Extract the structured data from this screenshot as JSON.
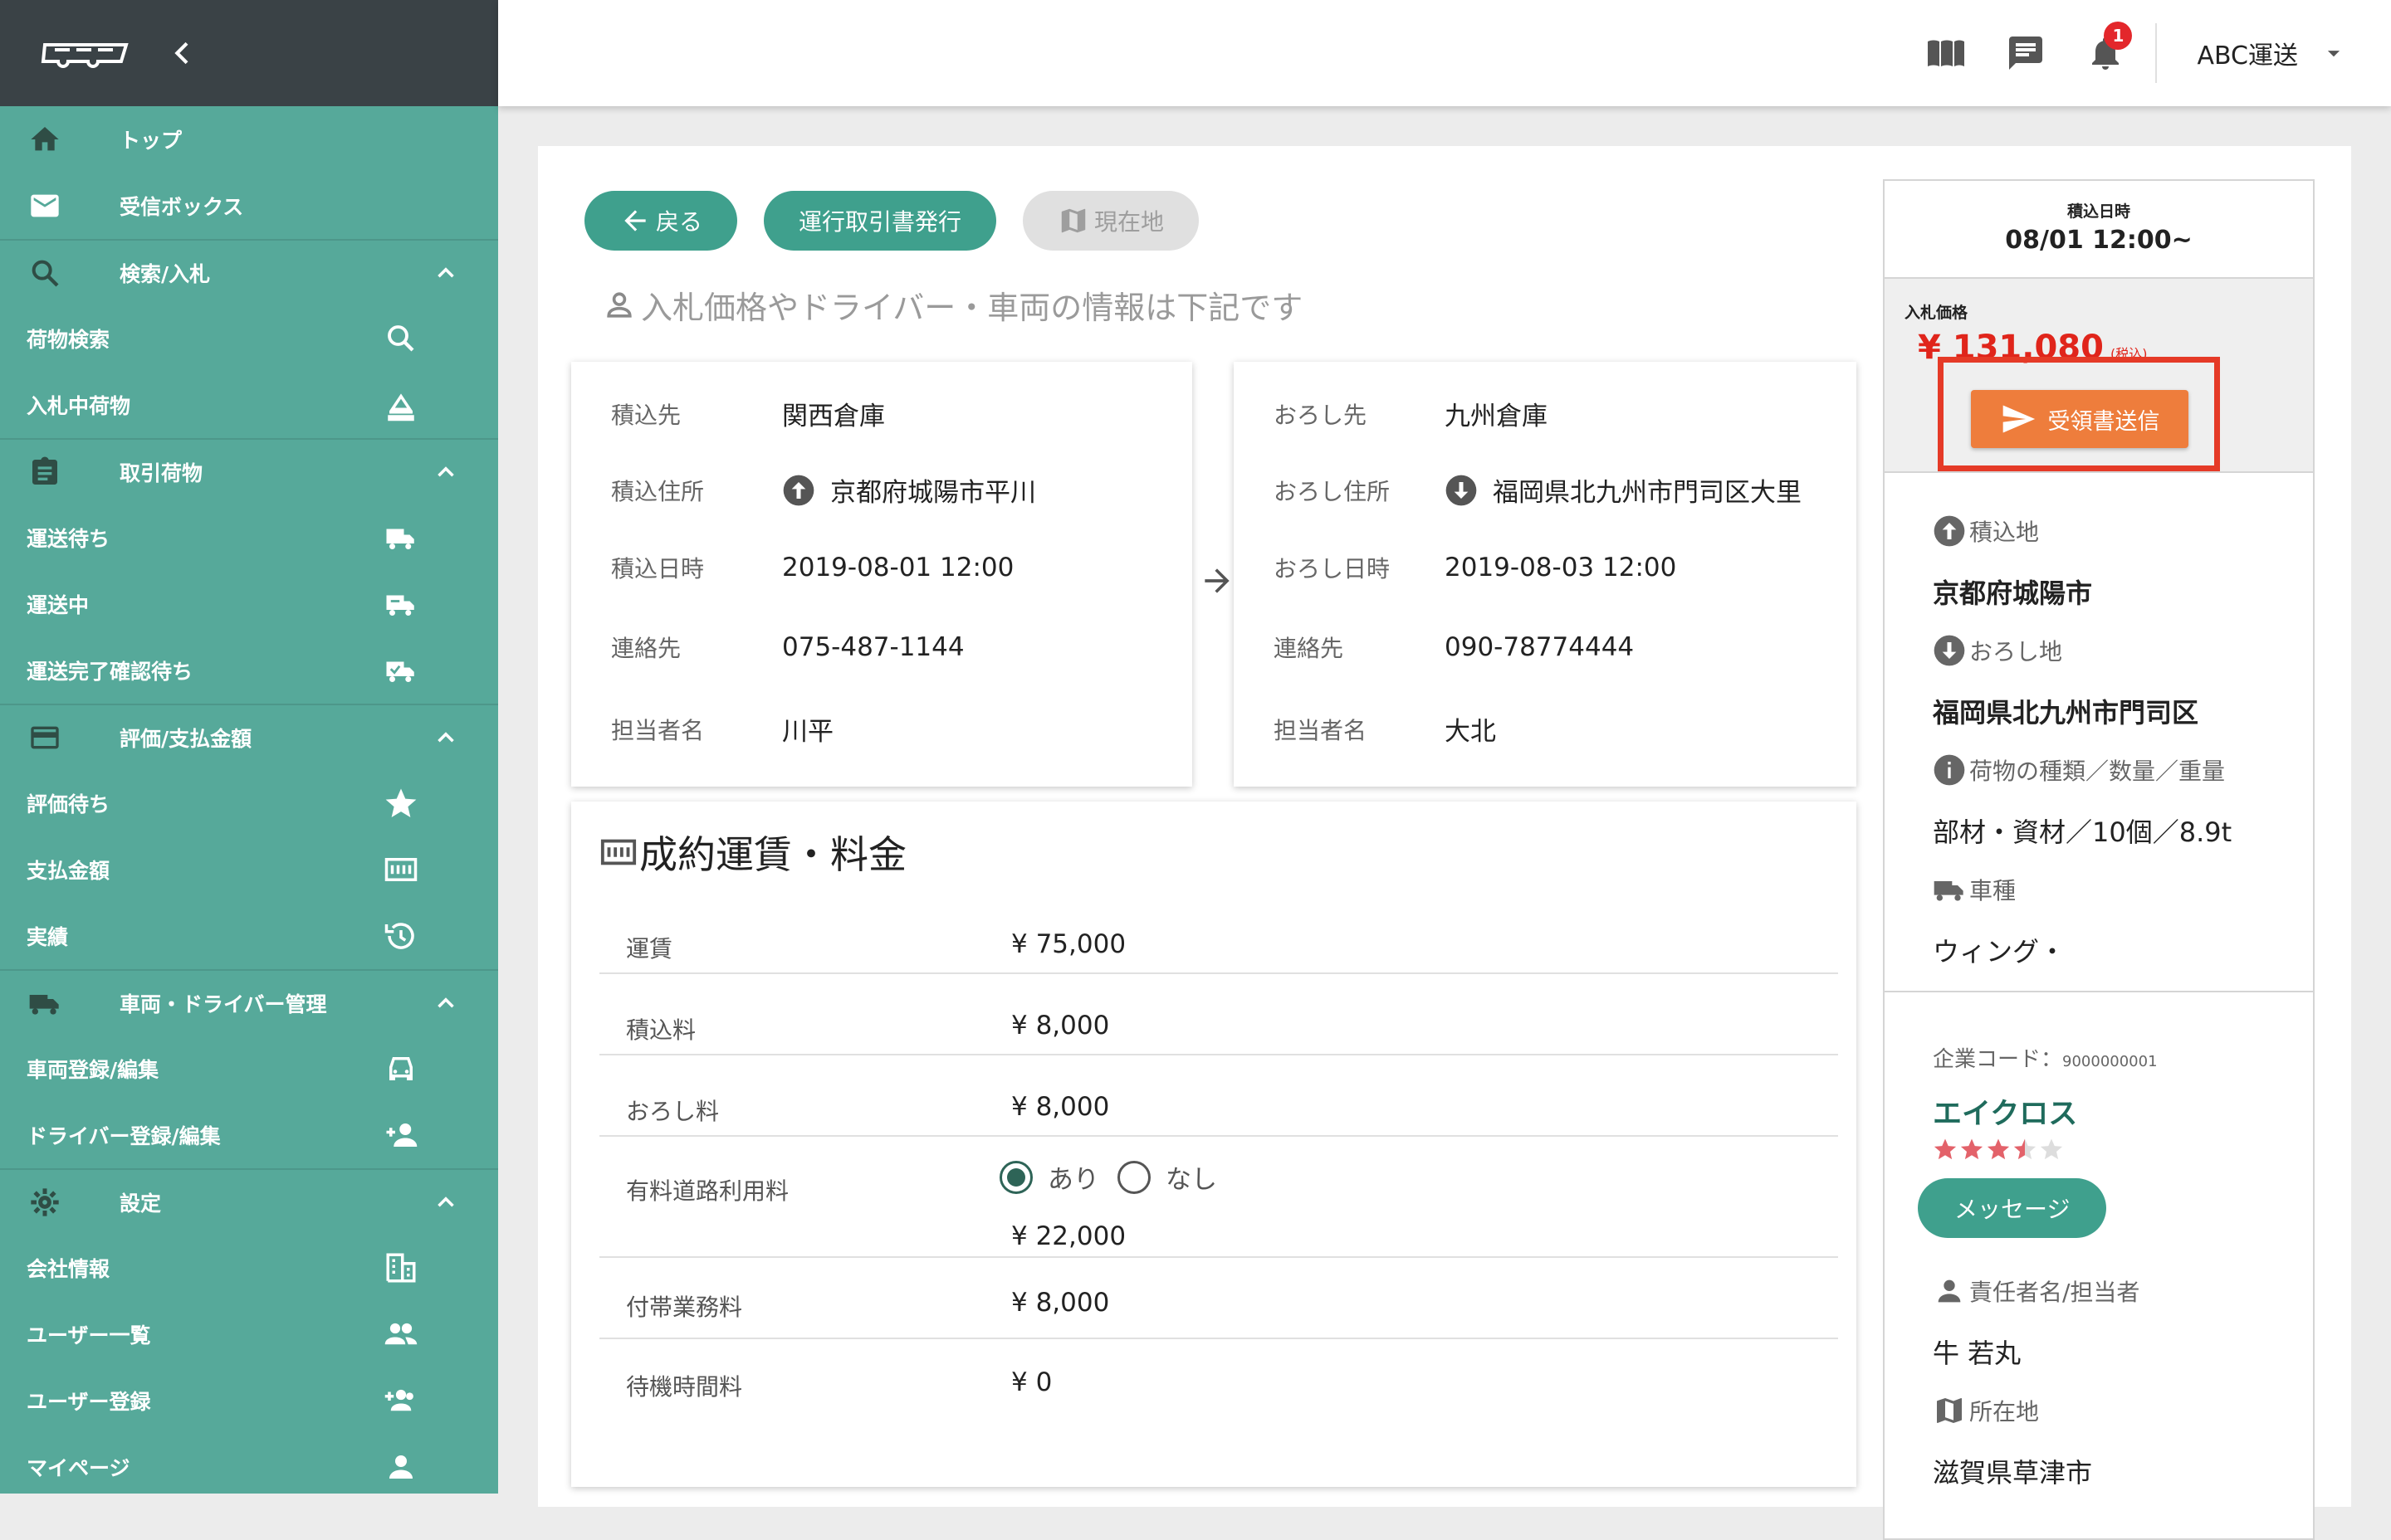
{
  "app": {
    "logo_icon": "truck-logo",
    "company_name": "ABC運送",
    "notification_count": "1"
  },
  "sidebar": {
    "top": {
      "label": "トップ"
    },
    "inbox": {
      "label": "受信ボックス"
    },
    "sections": [
      {
        "label": "検索/入札",
        "items": [
          {
            "label": "荷物検索"
          },
          {
            "label": "入札中荷物"
          }
        ]
      },
      {
        "label": "取引荷物",
        "items": [
          {
            "label": "運送待ち"
          },
          {
            "label": "運送中"
          },
          {
            "label": "運送完了確認待ち"
          }
        ]
      },
      {
        "label": "評価/支払金額",
        "items": [
          {
            "label": "評価待ち"
          },
          {
            "label": "支払金額"
          },
          {
            "label": "実績"
          }
        ]
      },
      {
        "label": "車両・ドライバー管理",
        "items": [
          {
            "label": "車両登録/編集"
          },
          {
            "label": "ドライバー登録/編集"
          }
        ]
      },
      {
        "label": "設定",
        "items": [
          {
            "label": "会社情報"
          },
          {
            "label": "ユーザー一覧"
          },
          {
            "label": "ユーザー登録"
          },
          {
            "label": "マイページ"
          }
        ]
      }
    ]
  },
  "actions": {
    "back": "戻る",
    "issue_doc": "運行取引書発行",
    "current_location": "現在地"
  },
  "info_message": "入札価格やドライバー・車両の情報は下記です",
  "loading": {
    "place_label": "積込先",
    "place": "関西倉庫",
    "address_label": "積込住所",
    "address": "京都府城陽市平川",
    "datetime_label": "積込日時",
    "datetime": "2019-08-01 12:00",
    "contact_label": "連絡先",
    "contact": "075-487-1144",
    "person_label": "担当者名",
    "person": "川平"
  },
  "unloading": {
    "place_label": "おろし先",
    "place": "九州倉庫",
    "address_label": "おろし住所",
    "address": "福岡県北九州市門司区大里",
    "datetime_label": "おろし日時",
    "datetime": "2019-08-03 12:00",
    "contact_label": "連絡先",
    "contact": "090-78774444",
    "person_label": "担当者名",
    "person": "大北"
  },
  "fees": {
    "title": "成約運賃・料金",
    "fare_label": "運賃",
    "fare": "¥ 75,000",
    "loading_fee_label": "積込料",
    "loading_fee": "¥ 8,000",
    "unloading_fee_label": "おろし料",
    "unloading_fee": "¥ 8,000",
    "toll_label": "有料道路利用料",
    "toll_yes": "あり",
    "toll_no": "なし",
    "toll": "¥ 22,000",
    "extra_label": "付帯業務料",
    "extra": "¥ 8,000",
    "waiting_label": "待機時間料",
    "waiting": "¥ 0"
  },
  "summary": {
    "date_label": "積込日時",
    "date": "08/01 12:00~",
    "price_label": "入札価格",
    "price": "¥ 131,080",
    "price_note": "(税込)",
    "send_receipt": "受領書送信",
    "origin_label": "積込地",
    "origin": "京都府城陽市",
    "dest_label": "おろし地",
    "dest": "福岡県北九州市門司区",
    "cargo_label": "荷物の種類／数量／重量",
    "cargo": "部材・資材／10個／8.9t",
    "vehicle_label": "車種",
    "vehicle": "ウィング・",
    "company_code_label": "企業コード：",
    "company_code": "9000000001",
    "company": "エイクロス",
    "rating": 3.5,
    "rating_max": 5,
    "message_button": "メッセージ",
    "manager_label": "責任者名/担当者",
    "manager": "牛 若丸",
    "location_label": "所在地",
    "location": "滋賀県草津市"
  },
  "colors": {
    "sidebar": "#56a99a",
    "sidebar_header": "#3a4246",
    "accent_green": "#3fa08d",
    "price_red": "#e0251b",
    "send_orange": "#ee7d3c",
    "highlight_red": "#e53a27",
    "star": "#e3626a"
  }
}
